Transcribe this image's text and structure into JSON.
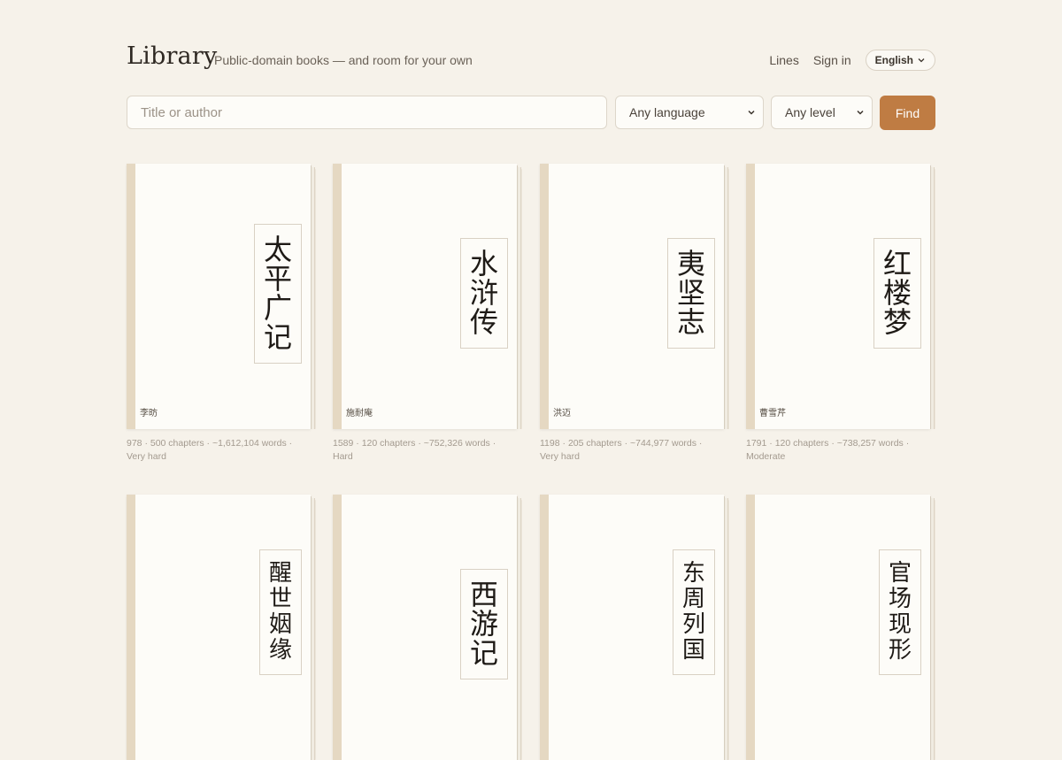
{
  "header": {
    "brand": "Library",
    "tagline": "Public-domain books — and room for your own",
    "nav": {
      "lines": "Lines",
      "sign_in": "Sign in",
      "language": "English"
    }
  },
  "search": {
    "placeholder": "Title or author",
    "language_select": "Any language",
    "level_select": "Any level",
    "find_label": "Find"
  },
  "books": [
    {
      "title": [
        "太",
        "平",
        "广",
        "记"
      ],
      "author": "李昉",
      "year": "978",
      "chapters": "500 chapters",
      "words": "~1,612,104 words",
      "difficulty": "Very hard"
    },
    {
      "title": [
        "水",
        "浒",
        "传"
      ],
      "author": "施耐庵",
      "year": "1589",
      "chapters": "120 chapters",
      "words": "~752,326 words",
      "difficulty": "Hard"
    },
    {
      "title": [
        "夷",
        "坚",
        "志"
      ],
      "author": "洪迈",
      "year": "1198",
      "chapters": "205 chapters",
      "words": "~744,977 words",
      "difficulty": "Very hard"
    },
    {
      "title": [
        "红",
        "楼",
        "梦"
      ],
      "author": "曹雪芹",
      "year": "1791",
      "chapters": "120 chapters",
      "words": "~738,257 words",
      "difficulty": "Moderate"
    },
    {
      "title": [
        "醒",
        "世",
        "姻",
        "缘"
      ]
    },
    {
      "title": [
        "西",
        "游",
        "记"
      ]
    },
    {
      "title": [
        "东",
        "周",
        "列",
        "国"
      ]
    },
    {
      "title": [
        "官",
        "场",
        "现",
        "形"
      ]
    }
  ]
}
